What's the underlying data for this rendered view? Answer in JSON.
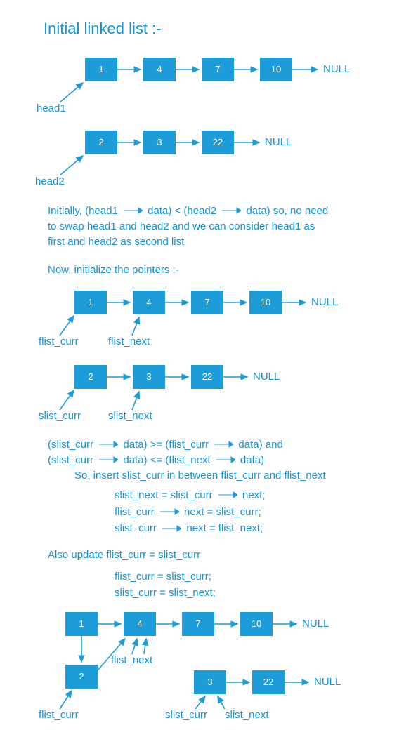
{
  "title": "Initial linked list :-",
  "null_label": "NULL",
  "list1": {
    "pointer": "head1",
    "nodes": [
      "1",
      "4",
      "7",
      "10"
    ]
  },
  "list2": {
    "pointer": "head2",
    "nodes": [
      "2",
      "3",
      "22"
    ]
  },
  "paragraph1": {
    "line1_a": "Initially, (head1",
    "line1_b": "data) < (head2",
    "line1_c": "data)  so, no need",
    "line2": "to swap head1 and head2  and we can consider head1 as",
    "line3": "first and head2 as second list"
  },
  "subtitle1": "Now, initialize the pointers :-",
  "ptr_labels": {
    "flist_curr": "flist_curr",
    "flist_next": "flist_next",
    "slist_curr": "slist_curr",
    "slist_next": "slist_next"
  },
  "condition": {
    "line1_a": "(slist_curr",
    "line1_b": "data) >= (flist_curr",
    "line1_c": "data)  and",
    "line2_a": "(slist_curr",
    "line2_b": "data) <= (flist_next",
    "line2_c": "data)",
    "line3": "So,  insert  slist_curr in between flist_curr and flist_next"
  },
  "code1": {
    "l1_a": "slist_next = slist_curr",
    "l1_b": "next;",
    "l2_a": "flist_curr",
    "l2_b": "next = slist_curr;",
    "l3_a": "slist_curr",
    "l3_b": "next = flist_next;"
  },
  "subtitle2": "Also update flist_curr = slist_curr",
  "code2": {
    "l1": "flist_curr = slist_curr;",
    "l2": "slist_curr = slist_next;"
  },
  "final_list": {
    "nodes_top": [
      "1",
      "4",
      "7",
      "10"
    ],
    "node_2": "2",
    "node_3": "3",
    "node_22": "22"
  },
  "chart_data": {
    "type": "diagram",
    "structure": "linked-list-merge",
    "list1_initial": [
      1,
      4,
      7,
      10
    ],
    "list2_initial": [
      2,
      3,
      22
    ],
    "step": "insert slist_curr between flist_curr and flist_next",
    "pointers_before": {
      "flist_curr": 1,
      "flist_next": 4,
      "slist_curr": 2,
      "slist_next": 3
    },
    "pointers_after": {
      "flist_curr": 2,
      "flist_next": 4,
      "slist_curr": 3,
      "slist_next": 22
    },
    "list1_after_chain": [
      1,
      2,
      4,
      7,
      10
    ],
    "list2_after_chain": [
      3,
      22
    ]
  }
}
